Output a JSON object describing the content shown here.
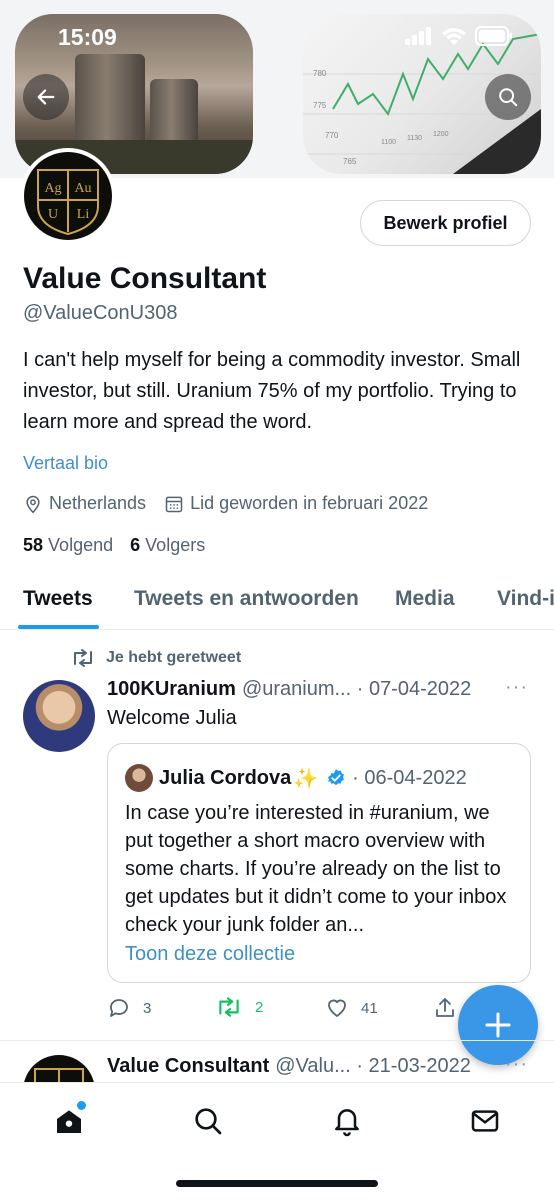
{
  "status_bar": {
    "time": "15:09"
  },
  "profile": {
    "avatar_letters": [
      "Ag",
      "Au",
      "U",
      "Li"
    ],
    "edit_button": "Bewerk profiel",
    "name": "Value Consultant",
    "handle": "@ValueConU308",
    "bio": "I can't help myself for being a commodity investor. Small investor, but still. Uranium 75% of my portfolio. Trying to learn more and spread the word.",
    "translate_bio": "Vertaal bio",
    "location": "Netherlands",
    "joined": "Lid geworden in februari 2022",
    "following_count": "58",
    "following_label": "Volgend",
    "followers_count": "6",
    "followers_label": "Volgers"
  },
  "banner_chart_ticks": [
    "780",
    "775",
    "770",
    "765",
    "1100",
    "1130",
    "1200"
  ],
  "tabs": [
    {
      "label": "Tweets",
      "active": true
    },
    {
      "label": "Tweets en antwoorden",
      "active": false
    },
    {
      "label": "Media",
      "active": false
    },
    {
      "label": "Vind-i",
      "active": false
    }
  ],
  "feed": {
    "retweet_notice": "Je hebt geretweet",
    "tweet": {
      "author": "100KUranium",
      "handle_date": "@uranium... · 07-04-2022",
      "more": "···",
      "text": "Welcome Julia",
      "quote": {
        "author": "Julia Cordova",
        "sparkle": "✨",
        "date": "· 06-04-2022",
        "text": "In case you’re interested in #uranium, we put together a short macro overview with some charts.  If you’re already on the list to get updates but it didn’t come to your inbox check your junk folder an...",
        "link": "Toon deze collectie"
      },
      "actions": {
        "replies": "3",
        "retweets": "2",
        "likes": "41"
      }
    },
    "next_tweet": {
      "author": "Value Consultant",
      "handle_date": "@Valu... · 21-03-2022",
      "more": "···"
    }
  },
  "colors": {
    "accent": "#1d9bf0",
    "retweet_green": "#17bf63",
    "secondary_text": "#536471"
  },
  "icons": [
    "back-arrow-icon",
    "search-icon",
    "location-icon",
    "calendar-icon",
    "retweet-icon",
    "reply-icon",
    "like-icon",
    "share-icon",
    "compose-plus-icon",
    "home-icon",
    "bell-icon",
    "mail-icon"
  ]
}
